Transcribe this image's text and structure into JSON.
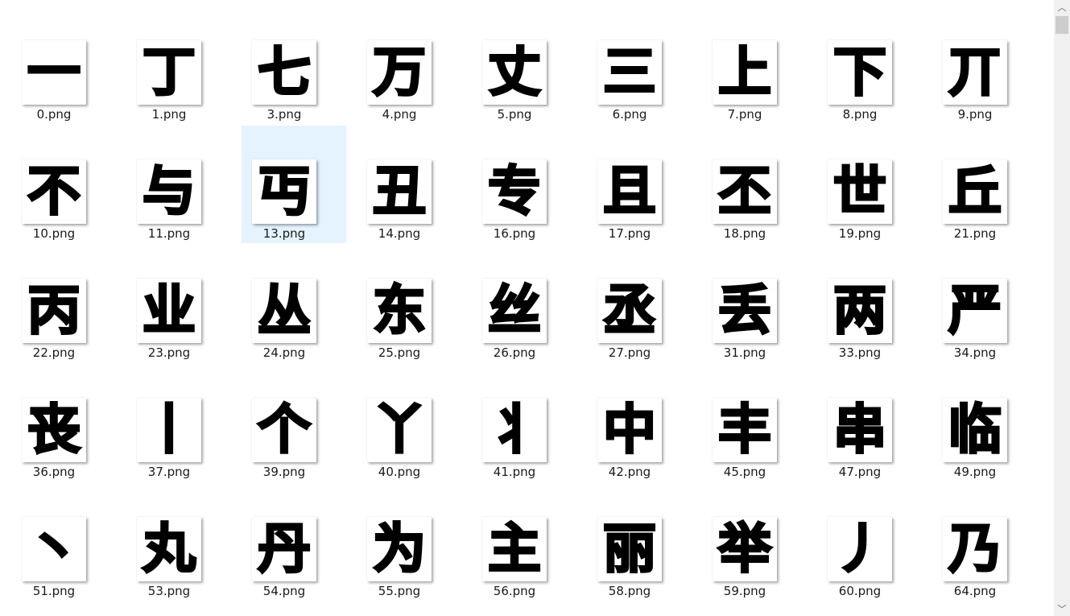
{
  "files": [
    {
      "name": "0.png",
      "glyph": "一"
    },
    {
      "name": "1.png",
      "glyph": "丁"
    },
    {
      "name": "3.png",
      "glyph": "七"
    },
    {
      "name": "4.png",
      "glyph": "万"
    },
    {
      "name": "5.png",
      "glyph": "丈"
    },
    {
      "name": "6.png",
      "glyph": "三"
    },
    {
      "name": "7.png",
      "glyph": "上"
    },
    {
      "name": "8.png",
      "glyph": "下"
    },
    {
      "name": "9.png",
      "glyph": "丌"
    },
    {
      "name": "10.png",
      "glyph": "不"
    },
    {
      "name": "11.png",
      "glyph": "与"
    },
    {
      "name": "13.png",
      "glyph": "丏",
      "selected": true
    },
    {
      "name": "14.png",
      "glyph": "丑"
    },
    {
      "name": "16.png",
      "glyph": "专"
    },
    {
      "name": "17.png",
      "glyph": "且"
    },
    {
      "name": "18.png",
      "glyph": "丕"
    },
    {
      "name": "19.png",
      "glyph": "世"
    },
    {
      "name": "21.png",
      "glyph": "丘"
    },
    {
      "name": "22.png",
      "glyph": "丙"
    },
    {
      "name": "23.png",
      "glyph": "业"
    },
    {
      "name": "24.png",
      "glyph": "丛"
    },
    {
      "name": "25.png",
      "glyph": "东"
    },
    {
      "name": "26.png",
      "glyph": "丝"
    },
    {
      "name": "27.png",
      "glyph": "丞"
    },
    {
      "name": "31.png",
      "glyph": "丢"
    },
    {
      "name": "33.png",
      "glyph": "两"
    },
    {
      "name": "34.png",
      "glyph": "严"
    },
    {
      "name": "36.png",
      "glyph": "丧"
    },
    {
      "name": "37.png",
      "glyph": "丨"
    },
    {
      "name": "39.png",
      "glyph": "个"
    },
    {
      "name": "40.png",
      "glyph": "丫"
    },
    {
      "name": "41.png",
      "glyph": "丬"
    },
    {
      "name": "42.png",
      "glyph": "中"
    },
    {
      "name": "45.png",
      "glyph": "丰"
    },
    {
      "name": "47.png",
      "glyph": "串"
    },
    {
      "name": "49.png",
      "glyph": "临"
    },
    {
      "name": "51.png",
      "glyph": "丶"
    },
    {
      "name": "53.png",
      "glyph": "丸"
    },
    {
      "name": "54.png",
      "glyph": "丹"
    },
    {
      "name": "55.png",
      "glyph": "为"
    },
    {
      "name": "56.png",
      "glyph": "主"
    },
    {
      "name": "58.png",
      "glyph": "丽"
    },
    {
      "name": "59.png",
      "glyph": "举"
    },
    {
      "name": "60.png",
      "glyph": "丿"
    },
    {
      "name": "64.png",
      "glyph": "乃"
    }
  ],
  "colors": {
    "selection": "#e5f3ff",
    "caption": "#1a1a1a",
    "glyph": "#000000"
  },
  "scrollbar": {
    "up_icon": "chevron-up-icon",
    "down_icon": "chevron-down-icon",
    "up_glyph": "︿",
    "down_glyph": "﹀"
  }
}
